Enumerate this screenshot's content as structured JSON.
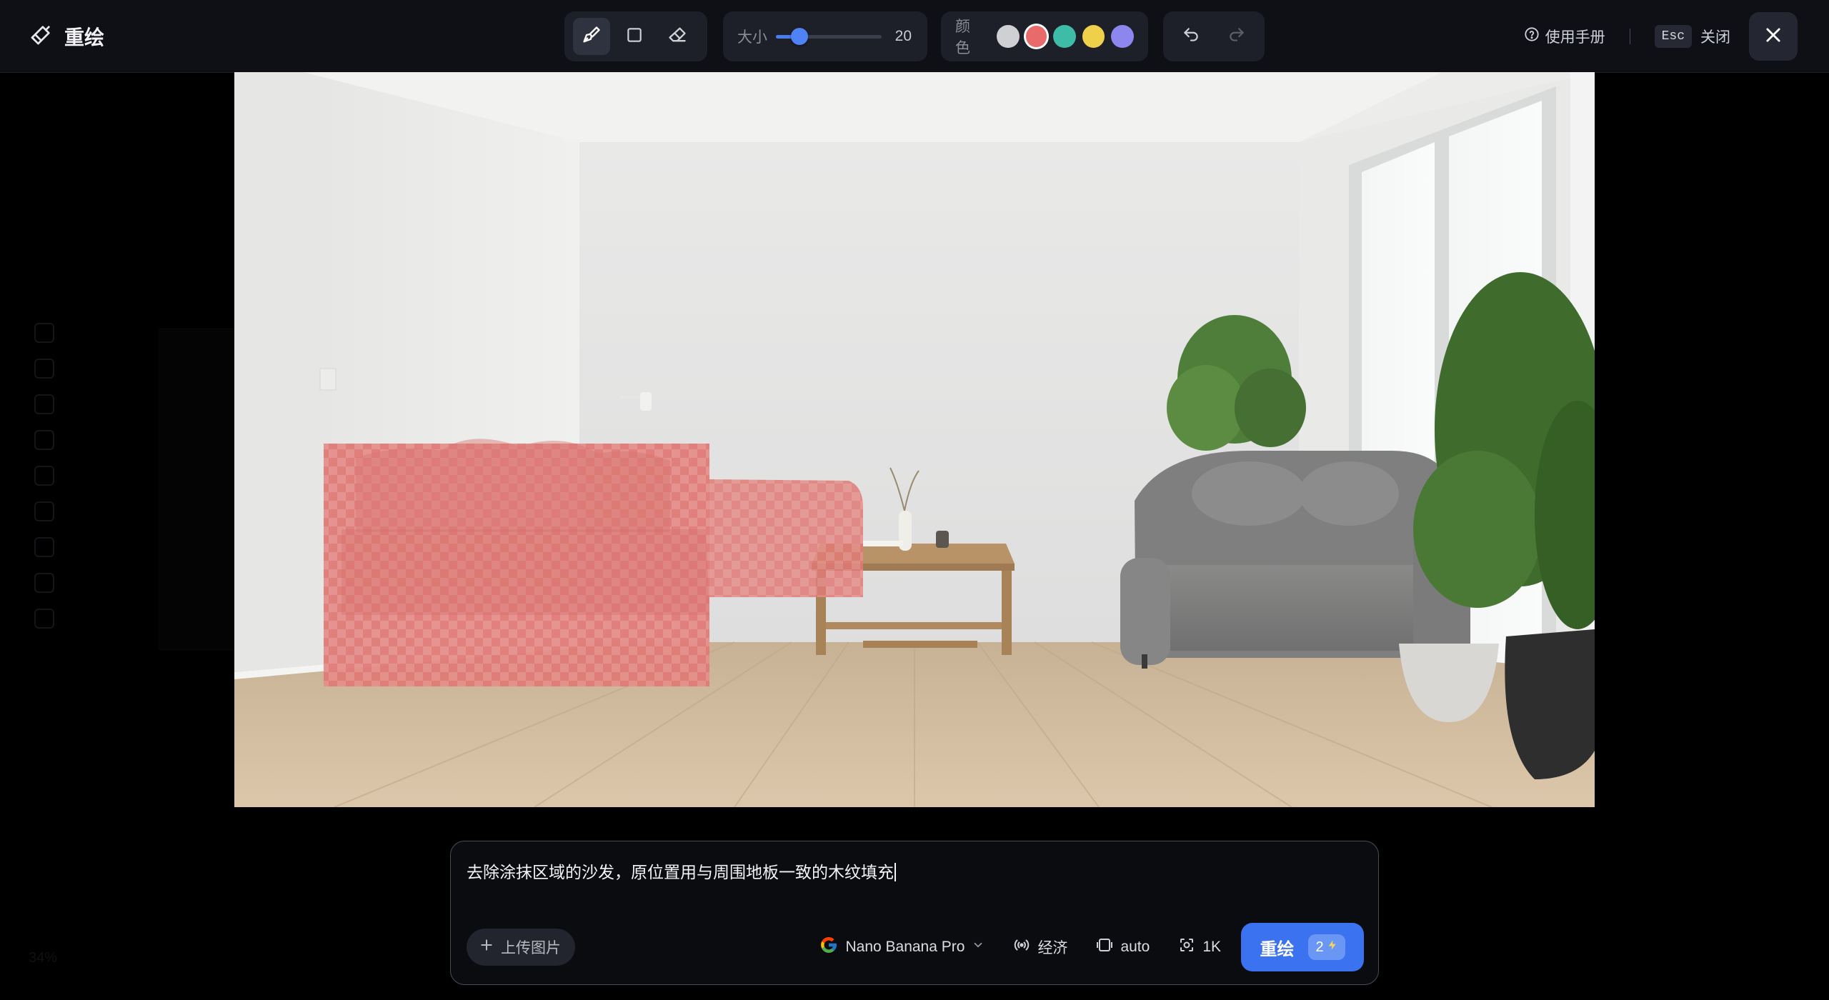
{
  "header": {
    "title": "重绘",
    "tools": [
      {
        "name": "brush",
        "icon": "brush-icon",
        "active": true
      },
      {
        "name": "rectangle",
        "icon": "rectangle-icon",
        "active": false
      },
      {
        "name": "eraser",
        "icon": "eraser-icon",
        "active": false
      }
    ],
    "size": {
      "label": "大小",
      "value": "20",
      "level": 0.22
    },
    "color": {
      "label": "颜色",
      "swatches": [
        "#cfd0d4",
        "#e86a6a",
        "#3dbda8",
        "#efd04a",
        "#8d86ee"
      ],
      "selected_index": 1
    },
    "history": {
      "undo_icon": "undo-icon",
      "redo_icon": "redo-icon"
    },
    "help_label": "使用手册",
    "esc_key": "Esc",
    "close_label": "关闭"
  },
  "canvas": {
    "mask_color": "#e86a6a",
    "description_icon": "room-image"
  },
  "prompt": {
    "text": "去除涂抹区域的沙发，原位置用与周围地板一致的木纹填充",
    "upload_label": "上传图片",
    "model": "Nano Banana Pro",
    "mode": "经济",
    "ratio": "auto",
    "resolution": "1K",
    "submit_label": "重绘",
    "cost": "2"
  },
  "background": {
    "zoom": "34%"
  }
}
